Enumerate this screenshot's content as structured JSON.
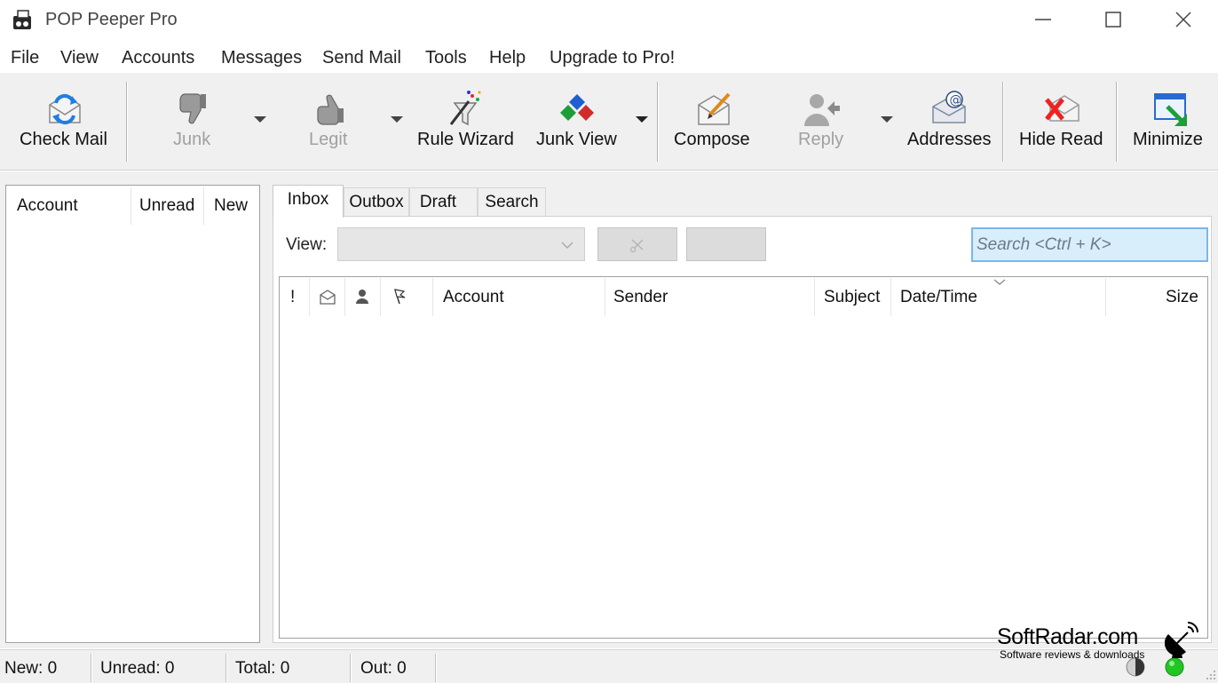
{
  "window": {
    "title": "POP Peeper Pro",
    "controls": {
      "minimize": "minimize-icon",
      "maximize": "maximize-icon",
      "close": "close-icon"
    }
  },
  "menu": {
    "items": [
      "File",
      "View",
      "Accounts",
      "Messages",
      "Send Mail",
      "Tools",
      "Help",
      "Upgrade to Pro!"
    ]
  },
  "toolbar": {
    "check_mail": "Check Mail",
    "junk": "Junk",
    "legit": "Legit",
    "rule_wizard": "Rule Wizard",
    "junk_view": "Junk View",
    "compose": "Compose",
    "reply": "Reply",
    "addresses": "Addresses",
    "hide_read": "Hide Read",
    "minimize": "Minimize"
  },
  "accounts_pane": {
    "columns": [
      "Account",
      "Unread",
      "New"
    ]
  },
  "tabs": [
    "Inbox",
    "Outbox",
    "Draft",
    "Search"
  ],
  "active_tab": "Inbox",
  "view_bar": {
    "label": "View:",
    "selected": "",
    "search_placeholder": "Search <Ctrl + K>"
  },
  "message_list": {
    "columns": [
      "!",
      "envelope-icon",
      "person-icon",
      "flag-icon",
      "Account",
      "Sender",
      "Subject",
      "Date/Time",
      "Size"
    ],
    "rows": []
  },
  "status": {
    "new": "New: 0",
    "unread": "Unread: 0",
    "total": "Total: 0",
    "out": "Out: 0"
  },
  "watermark": {
    "name": "SoftRadar.com",
    "tagline": "Software reviews & downloads"
  },
  "colors": {
    "toolbar_bg": "#f0f0f0",
    "search_bg": "#d9eefb",
    "search_border": "#7eb4ea",
    "status_led": "#22c622"
  }
}
